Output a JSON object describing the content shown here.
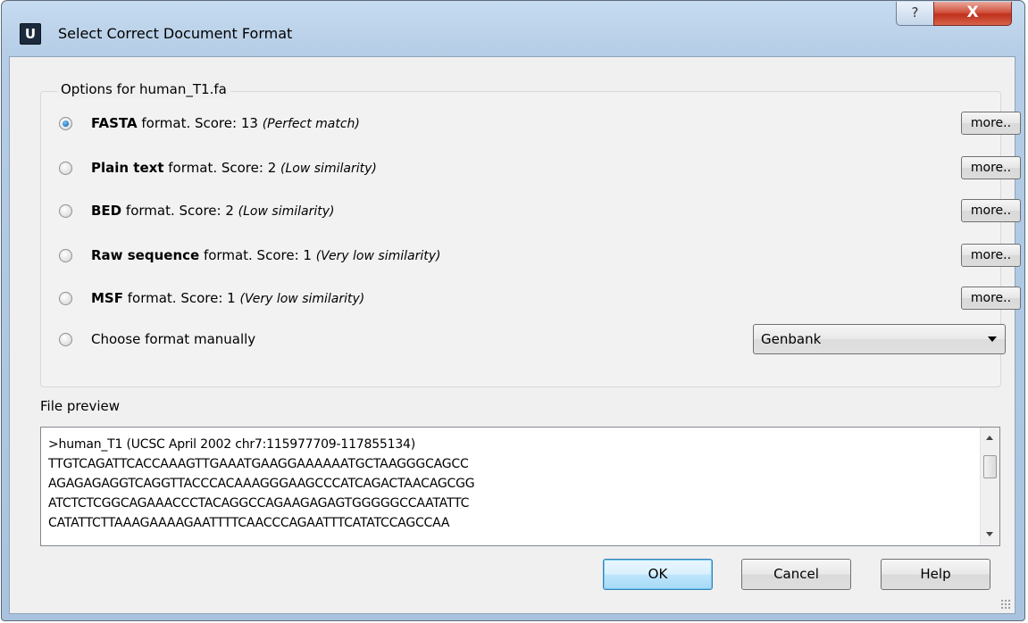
{
  "window": {
    "app_icon_letter": "U",
    "title": "Select Correct Document Format",
    "help_caption": "?",
    "close_caption": "X"
  },
  "options_group": {
    "label": "Options for human_T1.fa",
    "options": [
      {
        "name": "FASTA",
        "suffix": "format. Score: 13",
        "note": "(Perfect match)",
        "checked": true,
        "more_label": "more.."
      },
      {
        "name": "Plain text",
        "suffix": "format. Score: 2",
        "note": "(Low similarity)",
        "checked": false,
        "more_label": "more.."
      },
      {
        "name": "BED",
        "suffix": "format. Score: 2",
        "note": "(Low similarity)",
        "checked": false,
        "more_label": "more.."
      },
      {
        "name": "Raw sequence",
        "suffix": "format. Score: 1",
        "note": "(Very low similarity)",
        "checked": false,
        "more_label": "more.."
      },
      {
        "name": "MSF",
        "suffix": "format. Score: 1",
        "note": "(Very low similarity)",
        "checked": false,
        "more_label": "more.."
      }
    ],
    "manual": {
      "label": "Choose format manually",
      "checked": false,
      "selected_format": "Genbank"
    }
  },
  "preview": {
    "label": "File preview",
    "lines": [
      ">human_T1 (UCSC April 2002 chr7:115977709-117855134)",
      "TTGTCAGATTCACCAAAGTTGAAATGAAGGAAAAAATGCTAAGGGCAGCC",
      "AGAGAGAGGTCAGGTTACCCACAAAGGGAAGCCCATCAGACTAACAGCGG",
      "ATCTCTCGGCAGAAACCCTACAGGCCAGAAGAGAGTGGGGGCCAATATTC",
      "CATATTCTTAAAGAAAAGAATTTTCAACCCAGAATTTCATATCCAGCCAA"
    ]
  },
  "buttons": {
    "ok": "OK",
    "cancel": "Cancel",
    "help": "Help"
  },
  "colors": {
    "frame": "#b5cde6",
    "client_bg": "#f0f0f0",
    "close_button": "#c0311d",
    "default_button": "#bee6fd",
    "radio_selected": "#1e79c8"
  }
}
